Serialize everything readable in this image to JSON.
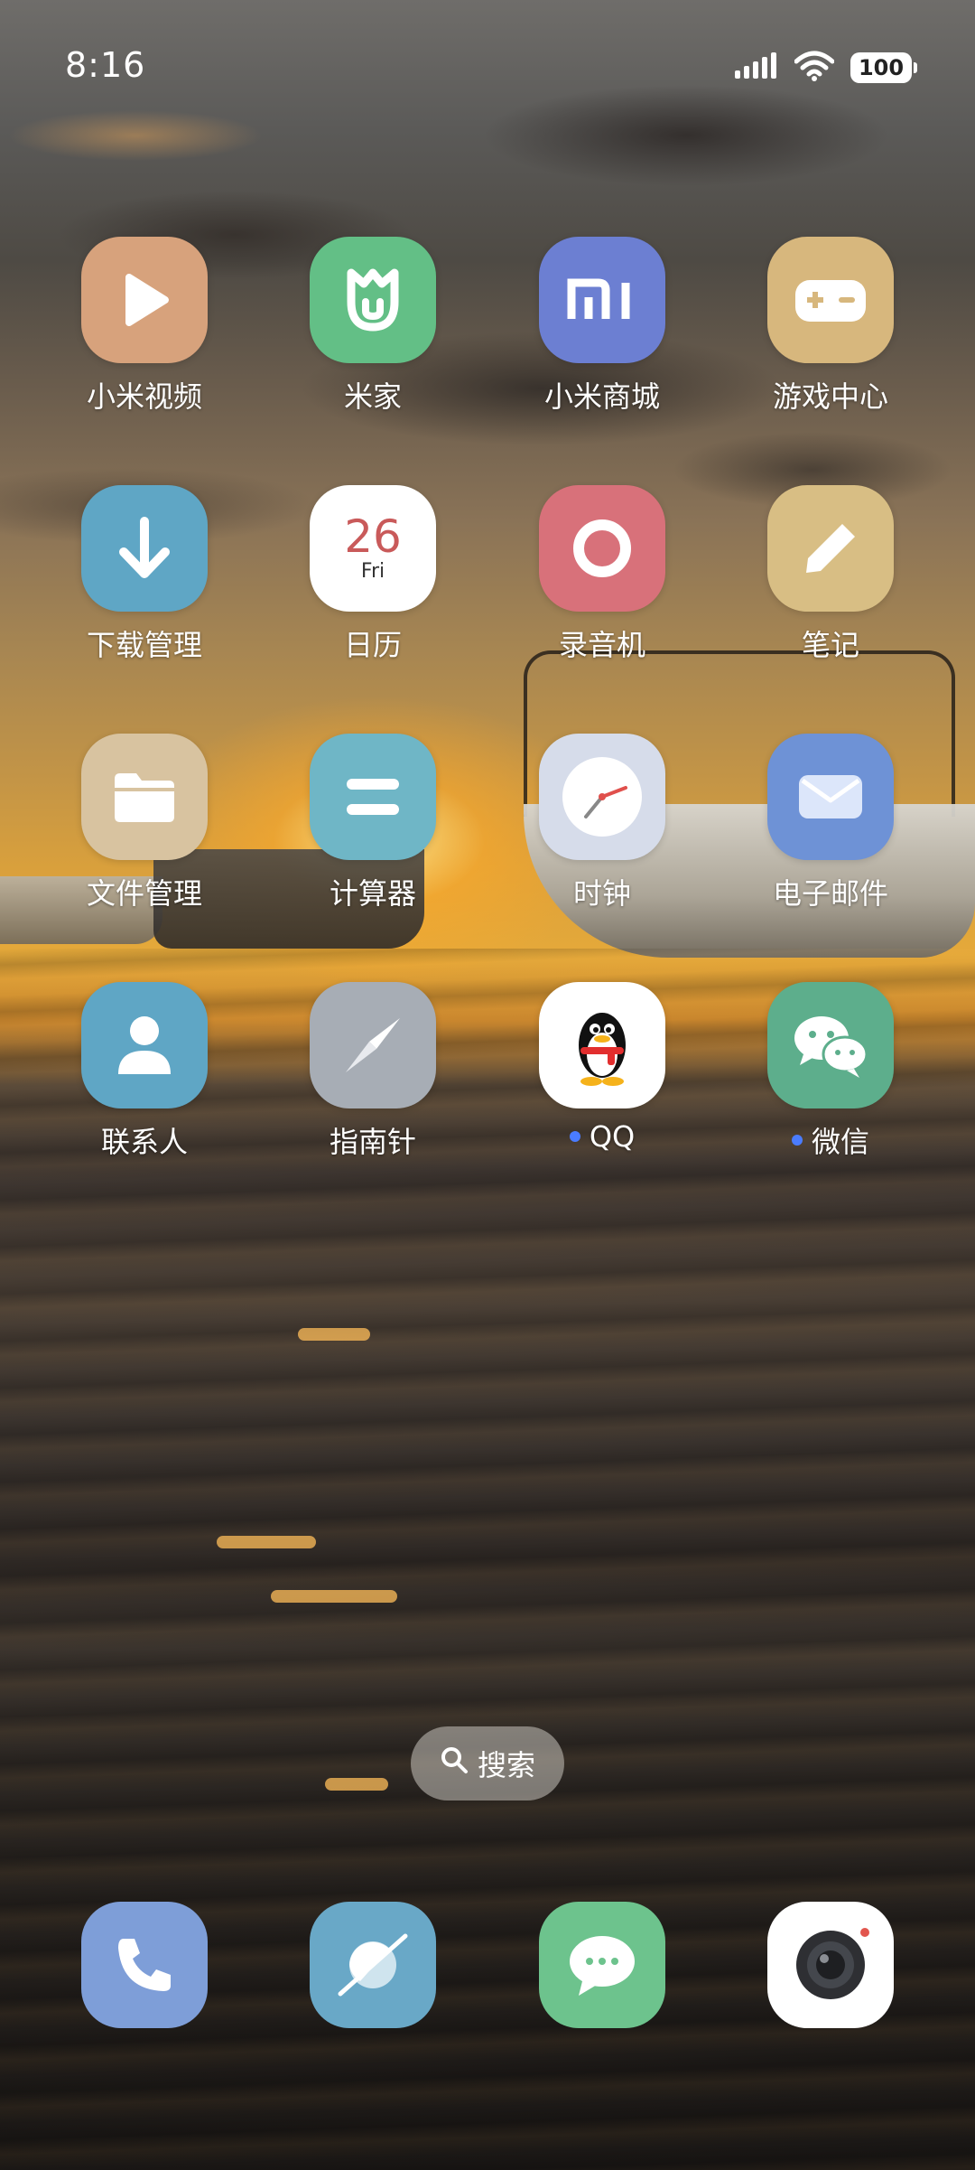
{
  "status_bar": {
    "time": "8:16",
    "battery": "100",
    "signal_icon": "cellular-signal-icon",
    "wifi_icon": "wifi-icon"
  },
  "apps": {
    "row1": [
      {
        "label": "小米视频",
        "color": "#D7A27C",
        "icon": "play-icon"
      },
      {
        "label": "米家",
        "color": "#63BF86",
        "icon": "mijia-icon"
      },
      {
        "label": "小米商城",
        "color": "#6C7FD2",
        "icon": "mi-logo-icon"
      },
      {
        "label": "游戏中心",
        "color": "#D7B77D",
        "icon": "gamepad-icon"
      }
    ],
    "row2": [
      {
        "label": "下载管理",
        "color": "#5FA6C5",
        "icon": "download-arrow-icon"
      },
      {
        "label": "日历",
        "color": "#FFFFFF",
        "icon": "calendar-icon",
        "date_number": "26",
        "date_day": "Fri"
      },
      {
        "label": "录音机",
        "color": "#D8717A",
        "icon": "record-ring-icon"
      },
      {
        "label": "笔记",
        "color": "#D8BE84",
        "icon": "pencil-icon"
      }
    ],
    "row3": [
      {
        "label": "文件管理",
        "color": "#D8C3A0",
        "icon": "folder-icon"
      },
      {
        "label": "计算器",
        "color": "#6FB6C6",
        "icon": "equals-icon"
      },
      {
        "label": "时钟",
        "color": "#D6DCEA",
        "icon": "clock-icon"
      },
      {
        "label": "电子邮件",
        "color": "#6E92D6",
        "icon": "envelope-icon"
      }
    ],
    "row4": [
      {
        "label": "联系人",
        "color": "#5FA6C5",
        "icon": "person-icon"
      },
      {
        "label": "指南针",
        "color": "#A7ADB5",
        "icon": "compass-needle-icon"
      },
      {
        "label": "QQ",
        "color": "#FFFFFF",
        "icon": "qq-penguin-icon",
        "new_badge": true
      },
      {
        "label": "微信",
        "color": "#5DAE8C",
        "icon": "wechat-bubbles-icon",
        "new_badge": true
      }
    ]
  },
  "search": {
    "label": "搜索",
    "icon": "search-icon"
  },
  "dock": [
    {
      "name": "phone",
      "color": "#7E9ED8",
      "icon": "phone-icon"
    },
    {
      "name": "browser",
      "color": "#69A8C7",
      "icon": "browser-orbit-icon"
    },
    {
      "name": "messages",
      "color": "#6DC38D",
      "icon": "message-bubble-icon"
    },
    {
      "name": "camera",
      "color": "#FFFFFF",
      "icon": "camera-lens-icon"
    }
  ]
}
